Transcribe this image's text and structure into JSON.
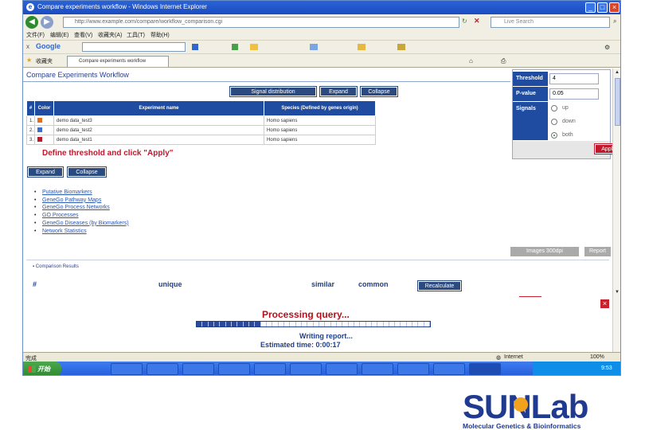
{
  "browser": {
    "title": "Compare experiments workflow - Windows Internet Explorer",
    "address": "http://www.example.com/compare/workflow_comparison.cgi",
    "search_placeholder": "Live Search",
    "google_label": "Google",
    "tab_title": "Compare experiments workflow",
    "favorites_label": "收藏夹",
    "status_left": "完成",
    "status_zone": "Internet",
    "status_zoom": "100%"
  },
  "page": {
    "title": "Compare Experiments Workflow",
    "buttons": {
      "signal_distribution": "Signal distribution",
      "expand": "Expand",
      "collapse": "Collapse",
      "expand2": "Expand",
      "collapse2": "Collapse",
      "apply": "Apply",
      "images": "Images 300dpi",
      "report": "Report",
      "recalculate": "Recalculate"
    },
    "table": {
      "headers": [
        "#",
        "Color",
        "Experiment name",
        "Species (Defined by genes origin)"
      ],
      "rows": [
        {
          "num": "1.",
          "color": "#e07020",
          "name": "demo data_test3",
          "species": "Homo sapiens"
        },
        {
          "num": "2.",
          "color": "#3a6fd0",
          "name": "demo data_test2",
          "species": "Homo sapiens"
        },
        {
          "num": "3.",
          "color": "#c0182c",
          "name": "demo data_test1",
          "species": "Homo sapiens"
        }
      ]
    },
    "instruction": "Define threshold and click \"Apply\"",
    "links": [
      "Putative Biomarkers",
      "GeneGo Pathway Maps",
      "GeneGo Process Networks",
      "GO Processes",
      "GeneGo Diseases (by Biomarkers)",
      "Network Statistics"
    ],
    "comparison_title": "Comparison Results",
    "columns": {
      "hash": "#",
      "unique": "unique",
      "similar": "similar",
      "common": "common"
    }
  },
  "panel": {
    "threshold_label": "Threshold",
    "threshold_value": "4",
    "pvalue_label": "P-value",
    "pvalue_value": "0.05",
    "signals_label": "Signals",
    "signal_options": [
      "up",
      "down",
      "both"
    ],
    "signal_selected": "both"
  },
  "progress": {
    "title": "Processing query...",
    "status": "Writing report...",
    "estimated": "Estimated time: 0:00:17",
    "filled_fraction": 0.27
  },
  "taskbar": {
    "start_label": "开始",
    "clock": "9:53"
  },
  "logo": {
    "name": "SUNLab",
    "subtitle": "Molecular Genetics & Bioinformatics"
  },
  "colors": {
    "accent": "#1f4ca0",
    "alert": "#c0182c"
  }
}
